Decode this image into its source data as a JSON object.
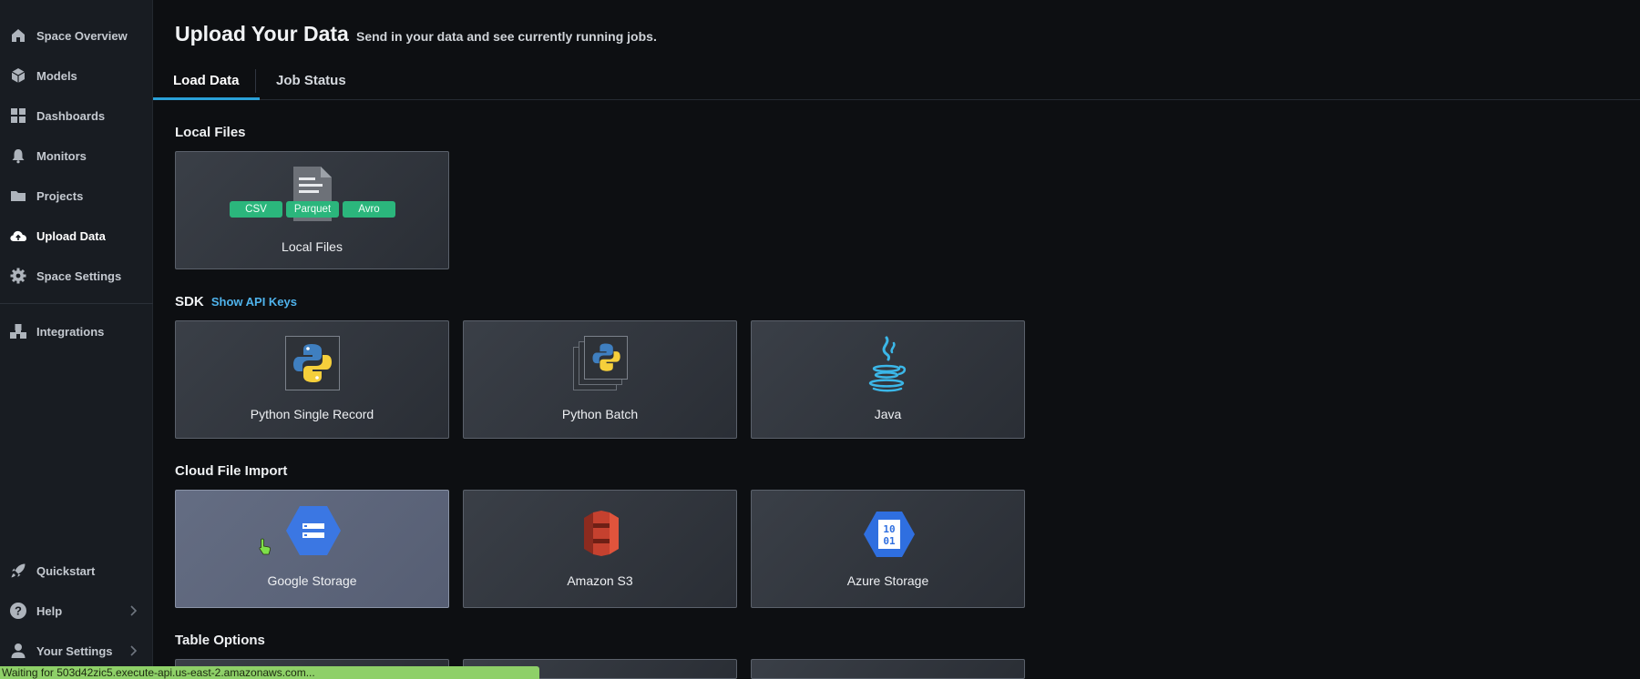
{
  "sidebar": {
    "items": [
      {
        "label": "Space Overview",
        "icon": "home-icon"
      },
      {
        "label": "Models",
        "icon": "cube-icon"
      },
      {
        "label": "Dashboards",
        "icon": "grid-icon"
      },
      {
        "label": "Monitors",
        "icon": "bell-icon"
      },
      {
        "label": "Projects",
        "icon": "folder-icon"
      },
      {
        "label": "Upload Data",
        "icon": "cloud-upload-icon",
        "active": true
      },
      {
        "label": "Space Settings",
        "icon": "gear-icon"
      },
      {
        "label": "Integrations",
        "icon": "puzzle-icon"
      }
    ],
    "bottom_items": [
      {
        "label": "Quickstart",
        "icon": "rocket-icon"
      },
      {
        "label": "Help",
        "icon": "help-icon"
      },
      {
        "label": "Your Settings",
        "icon": "user-icon"
      }
    ]
  },
  "header": {
    "title": "Upload Your Data",
    "subtitle": "Send in your data and see currently running jobs."
  },
  "tabs": [
    {
      "label": "Load Data",
      "active": true
    },
    {
      "label": "Job Status"
    }
  ],
  "sections": {
    "local": {
      "title": "Local Files",
      "card_label": "Local Files",
      "badges": [
        "CSV",
        "Parquet",
        "Avro"
      ]
    },
    "sdk": {
      "title": "SDK",
      "link": "Show API Keys",
      "cards": [
        "Python Single Record",
        "Python Batch",
        "Java"
      ]
    },
    "cloud": {
      "title": "Cloud File Import",
      "cards": [
        "Google Storage",
        "Amazon S3",
        "Azure Storage"
      ]
    },
    "table": {
      "title": "Table Options"
    }
  },
  "status_bar": "Waiting for 503d42zic5.execute-api.us-east-2.amazonaws.com...",
  "colors": {
    "accent": "#2aa1d8",
    "badge": "#2bb67c",
    "link": "#4fb3ec"
  }
}
